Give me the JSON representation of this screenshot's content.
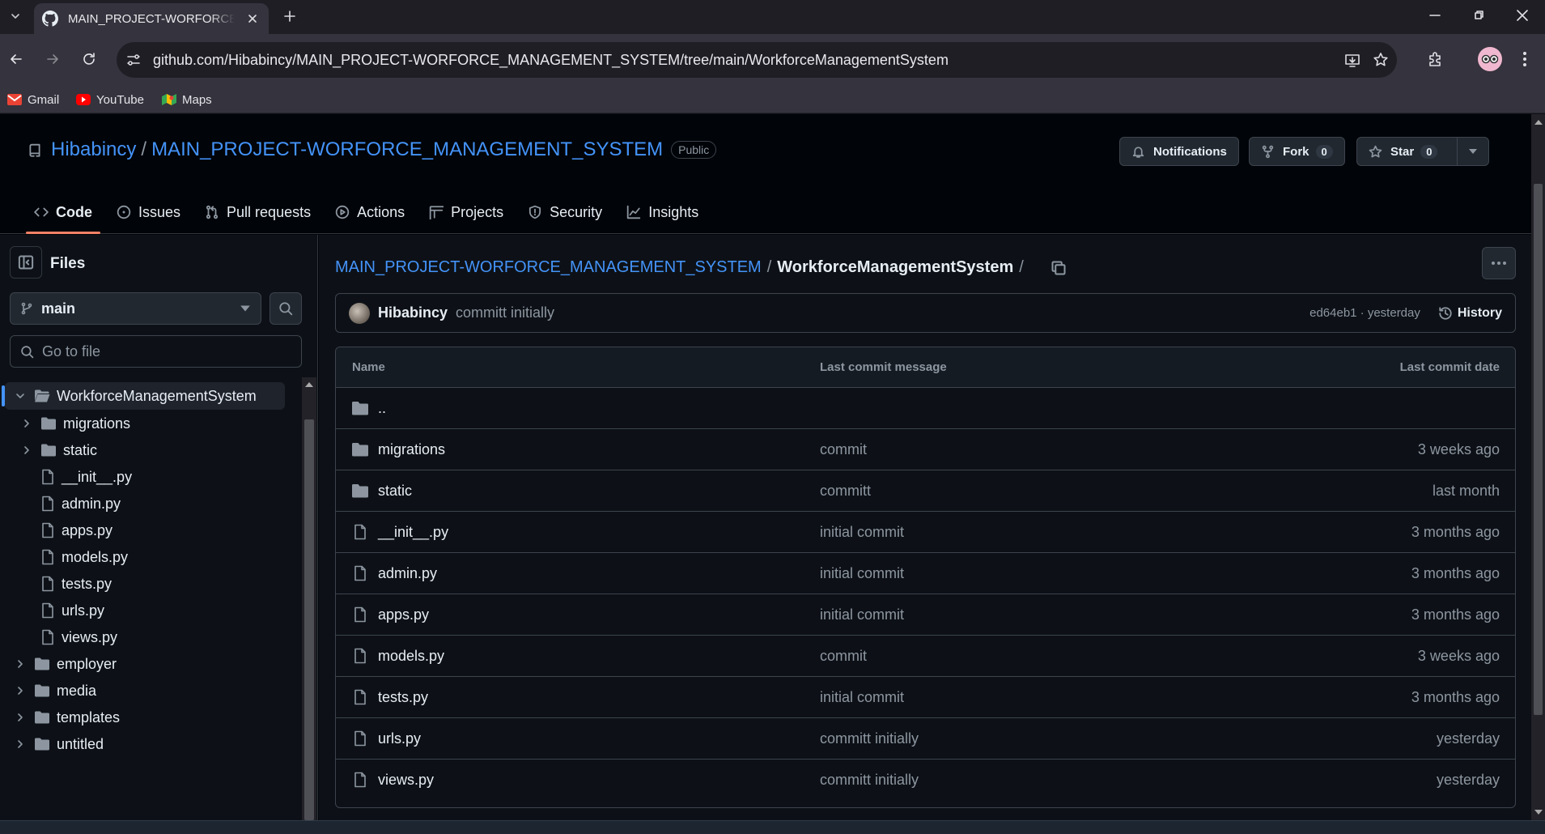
{
  "browser": {
    "tab_title": "MAIN_PROJECT-WORFORCE_MANAGEMENT_SYSTEM",
    "url": "github.com/Hibabincy/MAIN_PROJECT-WORFORCE_MANAGEMENT_SYSTEM/tree/main/WorkforceManagementSystem",
    "bookmarks": [
      {
        "label": "Gmail",
        "icon": "gmail-icon"
      },
      {
        "label": "YouTube",
        "icon": "youtube-icon"
      },
      {
        "label": "Maps",
        "icon": "maps-icon"
      }
    ]
  },
  "repo": {
    "owner": "Hibabincy",
    "separator": "/",
    "name": "MAIN_PROJECT-WORFORCE_MANAGEMENT_SYSTEM",
    "visibility": "Public",
    "notifications_label": "Notifications",
    "fork_label": "Fork",
    "fork_count": "0",
    "star_label": "Star",
    "star_count": "0"
  },
  "repo_nav": [
    {
      "label": "Code",
      "icon": "code-icon",
      "active": true
    },
    {
      "label": "Issues",
      "icon": "issue-icon"
    },
    {
      "label": "Pull requests",
      "icon": "pull-request-icon"
    },
    {
      "label": "Actions",
      "icon": "play-icon"
    },
    {
      "label": "Projects",
      "icon": "table-icon"
    },
    {
      "label": "Security",
      "icon": "shield-icon"
    },
    {
      "label": "Insights",
      "icon": "graph-icon"
    }
  ],
  "sidebar": {
    "title": "Files",
    "branch": "main",
    "search_placeholder": "Go to file",
    "tree": [
      {
        "label": "WorkforceManagementSystem",
        "type": "folder",
        "expanded": true,
        "selected": true,
        "depth": 0
      },
      {
        "label": "migrations",
        "type": "folder",
        "depth": 1
      },
      {
        "label": "static",
        "type": "folder",
        "depth": 1
      },
      {
        "label": "__init__.py",
        "type": "file",
        "depth": 1
      },
      {
        "label": "admin.py",
        "type": "file",
        "depth": 1
      },
      {
        "label": "apps.py",
        "type": "file",
        "depth": 1
      },
      {
        "label": "models.py",
        "type": "file",
        "depth": 1
      },
      {
        "label": "tests.py",
        "type": "file",
        "depth": 1
      },
      {
        "label": "urls.py",
        "type": "file",
        "depth": 1
      },
      {
        "label": "views.py",
        "type": "file",
        "depth": 1
      },
      {
        "label": "employer",
        "type": "folder",
        "depth": 0
      },
      {
        "label": "media",
        "type": "folder",
        "depth": 0
      },
      {
        "label": "templates",
        "type": "folder",
        "depth": 0
      },
      {
        "label": "untitled",
        "type": "folder",
        "depth": 0
      }
    ]
  },
  "main": {
    "breadcrumb_repo": "MAIN_PROJECT-WORFORCE_MANAGEMENT_SYSTEM",
    "breadcrumb_sep": "/",
    "breadcrumb_current": "WorkforceManagementSystem",
    "latest_commit": {
      "author": "Hibabincy",
      "message": "committ initially",
      "meta": "ed64eb1 · yesterday",
      "history_label": "History"
    },
    "table": {
      "headers": {
        "name": "Name",
        "message": "Last commit message",
        "date": "Last commit date"
      },
      "rows": [
        {
          "name": "..",
          "type": "folder",
          "message": "",
          "date": ""
        },
        {
          "name": "migrations",
          "type": "folder",
          "message": "commit",
          "date": "3 weeks ago"
        },
        {
          "name": "static",
          "type": "folder",
          "message": "committ",
          "date": "last month"
        },
        {
          "name": "__init__.py",
          "type": "file",
          "message": "initial commit",
          "date": "3 months ago"
        },
        {
          "name": "admin.py",
          "type": "file",
          "message": "initial commit",
          "date": "3 months ago"
        },
        {
          "name": "apps.py",
          "type": "file",
          "message": "initial commit",
          "date": "3 months ago"
        },
        {
          "name": "models.py",
          "type": "file",
          "message": "commit",
          "date": "3 weeks ago"
        },
        {
          "name": "tests.py",
          "type": "file",
          "message": "initial commit",
          "date": "3 months ago"
        },
        {
          "name": "urls.py",
          "type": "file",
          "message": "committ initially",
          "date": "yesterday"
        },
        {
          "name": "views.py",
          "type": "file",
          "message": "committ initially",
          "date": "yesterday"
        }
      ]
    }
  },
  "colors": {
    "link": "#4493f8",
    "accent_underline": "#f78166",
    "bg": "#0d1117",
    "muted": "#8d96a0"
  }
}
